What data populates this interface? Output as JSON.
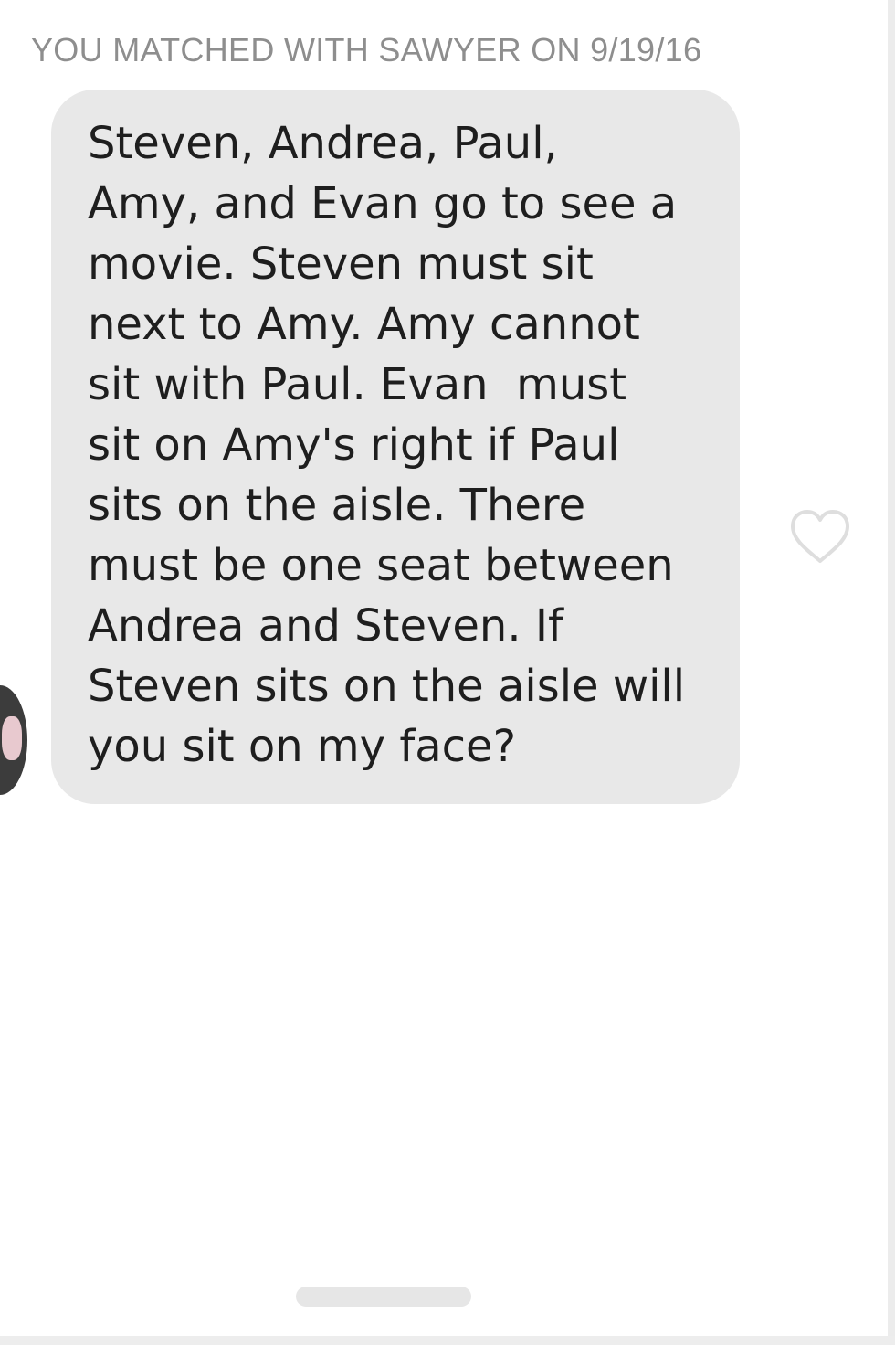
{
  "header": {
    "match_text": "YOU MATCHED WITH SAWYER ON 9/19/16"
  },
  "message": {
    "text_lines": [
      "Steven, Andrea, Paul,",
      "Amy, and Evan go to see a",
      "movie. Steven must sit",
      "next to Amy. Amy cannot",
      "sit with Paul. Evan  must",
      "sit on Amy's right if Paul",
      "sits on the aisle. There",
      "must be one seat between",
      "Andrea and Steven. If",
      "Steven sits on the aisle will",
      "you sit on my face?"
    ],
    "like_icon": "heart-outline-icon",
    "sender_avatar_icon": "avatar-photo"
  },
  "colors": {
    "background": "#ffffff",
    "bubble": "#e8e8e8",
    "header_text": "#8e8e8e",
    "message_text": "#1e1e1e",
    "heart_stroke": "#dedede"
  }
}
